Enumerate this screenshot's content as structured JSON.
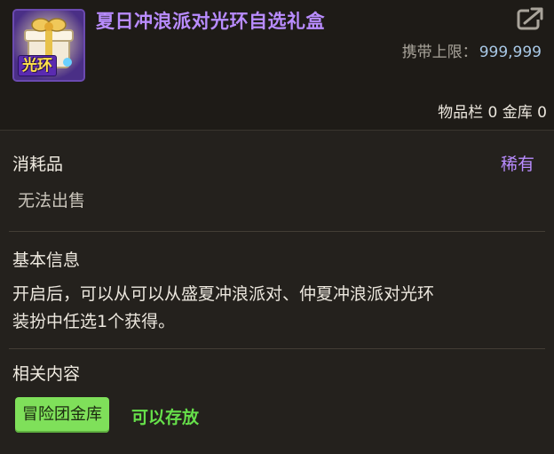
{
  "item": {
    "title": "夏日冲浪派对光环自选礼盒",
    "icon_tag": "光环",
    "carry_limit_label": "携带上限：",
    "carry_limit_value": "999,999",
    "storage_line": "物品栏 0 金库 0"
  },
  "category": {
    "type": "消耗品",
    "rarity": "稀有",
    "sell_status": "无法出售"
  },
  "basic_info": {
    "heading": "基本信息",
    "lines": [
      "开启后，可以从可以从盛夏冲浪派对、仲夏冲浪派对光环",
      "装扮中任选1个获得。"
    ]
  },
  "related": {
    "heading": "相关内容",
    "badge": "冒险团金库",
    "status": "可以存放"
  },
  "colors": {
    "title": "#b98cff",
    "rarity": "#b98cff",
    "badge_bg": "#7fe05a",
    "status": "#66e04a"
  },
  "icons": [
    "gift-box-icon",
    "share-icon"
  ]
}
